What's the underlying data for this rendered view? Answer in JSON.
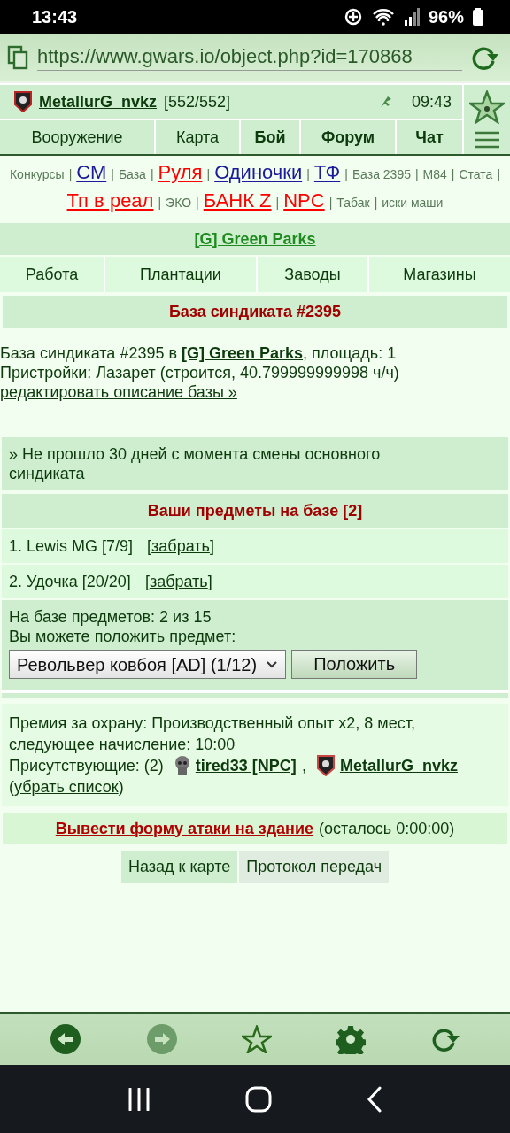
{
  "status_bar": {
    "time": "13:43",
    "battery": "96%"
  },
  "address_bar": {
    "url": "https://www.gwars.io/object.php?id=170868"
  },
  "header": {
    "player": "MetallurG_nvkz",
    "hp": "[552/552]",
    "time": "09:43"
  },
  "nav_tabs": [
    {
      "label": "Вооружение",
      "bold": false
    },
    {
      "label": "Карта",
      "bold": false
    },
    {
      "label": "Бой",
      "bold": true
    },
    {
      "label": "Форум",
      "bold": true
    },
    {
      "label": "Чат",
      "bold": true
    }
  ],
  "quick_links": [
    {
      "kind": "plain",
      "label": "Конкурсы"
    },
    {
      "kind": "sep",
      "label": "|"
    },
    {
      "kind": "link",
      "label": "СМ",
      "color": "#1a1a9a"
    },
    {
      "kind": "sep",
      "label": "|"
    },
    {
      "kind": "plain",
      "label": "База"
    },
    {
      "kind": "sep",
      "label": "|"
    },
    {
      "kind": "link",
      "label": "Руля",
      "color": "#ff0000"
    },
    {
      "kind": "sep",
      "label": "|"
    },
    {
      "kind": "link",
      "label": "Одиночки",
      "color": "#1a1a9a"
    },
    {
      "kind": "sep",
      "label": "|"
    },
    {
      "kind": "link",
      "label": "ТФ",
      "color": "#1a1a9a"
    },
    {
      "kind": "sep",
      "label": "|"
    },
    {
      "kind": "plain",
      "label": "База 2395"
    },
    {
      "kind": "sep",
      "label": "|"
    },
    {
      "kind": "plain",
      "label": "M84"
    },
    {
      "kind": "sep",
      "label": "|"
    },
    {
      "kind": "plain",
      "label": "Стата"
    },
    {
      "kind": "sep",
      "label": "|"
    },
    {
      "kind": "link",
      "label": "Тп в реал",
      "color": "#ff0000"
    },
    {
      "kind": "sep",
      "label": "|"
    },
    {
      "kind": "plain",
      "label": "ЭКО"
    },
    {
      "kind": "sep",
      "label": "|"
    },
    {
      "kind": "link",
      "label": "БАНК Z",
      "color": "#ff0000"
    },
    {
      "kind": "sep",
      "label": "|"
    },
    {
      "kind": "link",
      "label": "NPC",
      "color": "#ff0000"
    },
    {
      "kind": "sep",
      "label": "|"
    },
    {
      "kind": "plain",
      "label": "Табак"
    },
    {
      "kind": "sep",
      "label": "|"
    },
    {
      "kind": "plain",
      "label": "иски маши"
    }
  ],
  "syndicate_title": "[G] Green Parks",
  "district_links": [
    "Работа",
    "Плантации",
    "Заводы",
    "Магазины"
  ],
  "base_heading": "База синдиката #2395",
  "base_info": {
    "before": "База синдиката #2395 в",
    "link": "[G] Green Parks",
    "after": ", площадь: 1",
    "annexes": "Пристройки: Лазарет (строится, 40.799999999998 ч/ч)",
    "edit_link": "редактировать описание базы »"
  },
  "notice": "» Не прошло 30 дней с момента смены основного синдиката",
  "items_heading": "Ваши предметы на базе [2]",
  "items": [
    {
      "text": "1. Lewis MG [7/9]",
      "pre": "[",
      "link": "забрать",
      "post": "]"
    },
    {
      "text": "2. Удочка [20/20]",
      "pre": "[",
      "link": "забрать",
      "post": "]"
    }
  ],
  "storage": {
    "count": "На базе предметов: 2 из 15",
    "prompt": "Вы можете положить предмет:",
    "select": "Револьвер ковбоя [AD] (1/12)",
    "button": "Положить"
  },
  "guard": {
    "text": "Премия за охрану: Производственный опыт x2, 8 мест, следующее начисление: 10:00",
    "present": "Присутствующие: (2)",
    "people": [
      {
        "kind": "npc",
        "name": "tired33 [NPC]",
        "sep": ","
      },
      {
        "kind": "player",
        "name": "MetallurG_nvkz"
      }
    ],
    "pre": "(",
    "link": "убрать список",
    "post": ")"
  },
  "attack": {
    "link": "Вывести форму атаки на здание",
    "note": "(осталось 0:00:00)"
  },
  "bottom_buttons": [
    {
      "label": "Назад к карте",
      "selected": true
    },
    {
      "label": "Протокол передач",
      "selected": false
    }
  ],
  "toolbar": [
    {
      "kind": "back",
      "disabled": false
    },
    {
      "kind": "forward",
      "disabled": true
    },
    {
      "kind": "star",
      "disabled": false
    },
    {
      "kind": "settings",
      "disabled": false
    },
    {
      "kind": "reload",
      "disabled": false
    }
  ]
}
